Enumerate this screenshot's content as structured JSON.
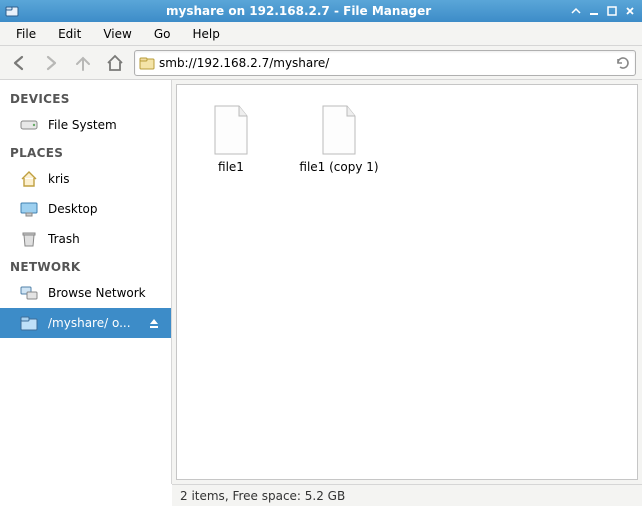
{
  "window": {
    "title": "myshare on 192.168.2.7 - File Manager"
  },
  "menubar": {
    "file": "File",
    "edit": "Edit",
    "view": "View",
    "go": "Go",
    "help": "Help"
  },
  "toolbar": {
    "address": "smb://192.168.2.7/myshare/"
  },
  "sidebar": {
    "sections": {
      "devices": "DEVICES",
      "places": "PLACES",
      "network": "NETWORK"
    },
    "devices": [
      {
        "label": "File System",
        "icon": "drive-icon"
      }
    ],
    "places": [
      {
        "label": "kris",
        "icon": "home-icon"
      },
      {
        "label": "Desktop",
        "icon": "desktop-icon"
      },
      {
        "label": "Trash",
        "icon": "trash-icon"
      }
    ],
    "network": [
      {
        "label": "Browse Network",
        "icon": "network-icon"
      },
      {
        "label": "/myshare/ o...",
        "icon": "folder-remote-icon",
        "active": true,
        "ejectable": true
      }
    ]
  },
  "files": [
    {
      "name": "file1"
    },
    {
      "name": "file1 (copy 1)"
    }
  ],
  "statusbar": {
    "text": "2 items, Free space: 5.2 GB"
  }
}
